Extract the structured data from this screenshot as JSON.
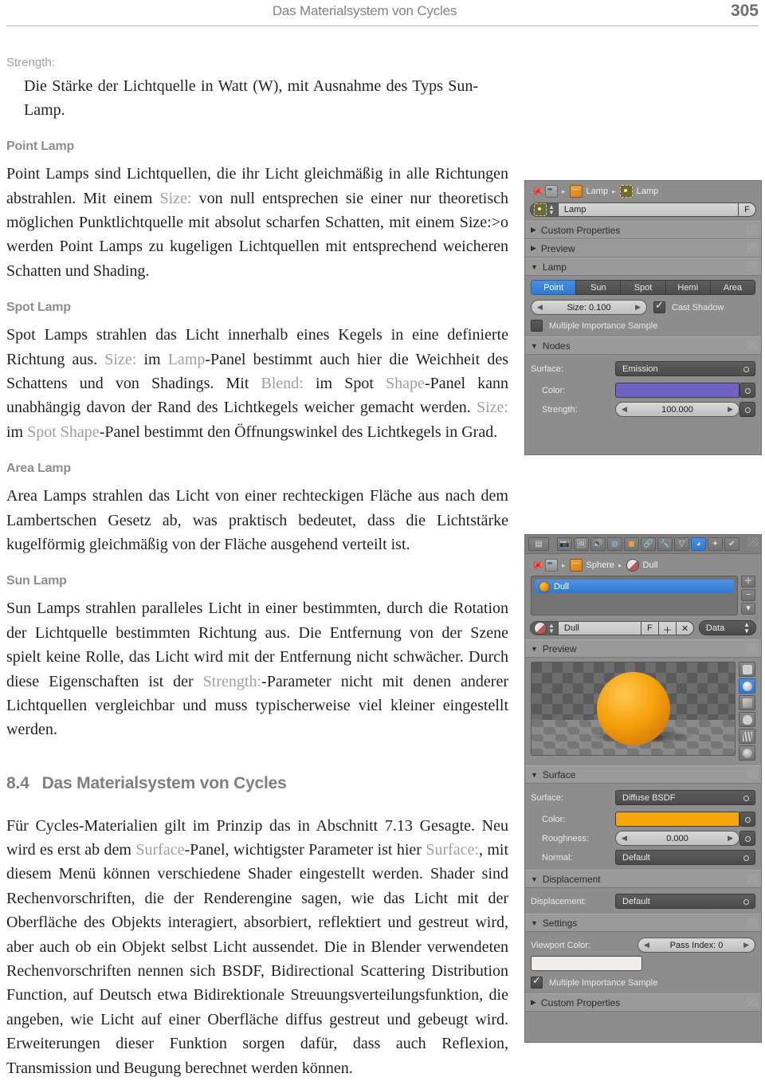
{
  "header": {
    "title": "Das Materialsystem von Cycles",
    "page_number": "305"
  },
  "content": {
    "term_strength": "Strength:",
    "term_strength_def": "Die Stärke der Lichtquelle in Watt (W), mit Ausnahme des Typs Sun-Lamp.",
    "h_point_lamp": "Point Lamp",
    "p_point_1": "Point Lamps sind Lichtquellen, die ihr Licht gleichmäßig in alle Richtungen abstrahlen. Mit einem ",
    "p_point_ui1": "Size:",
    "p_point_2": " von null entsprechen sie einer nur theoretisch möglichen Punktlichtquelle mit absolut scharfen Schatten, mit einem Size:>o werden Point Lamps zu kugeligen Lichtquellen mit entsprechend weicheren Schatten und Shading.",
    "h_spot_lamp": "Spot Lamp",
    "p_spot_1": "Spot Lamps strahlen das Licht innerhalb eines Kegels in eine definierte Richtung aus. ",
    "p_spot_ui1": "Size:",
    "p_spot_2": " im ",
    "p_spot_ui2": "Lamp",
    "p_spot_3": "-Panel bestimmt auch hier die Weichheit des Schattens und von Shadings. Mit ",
    "p_spot_ui3": "Blend:",
    "p_spot_4": " im Spot ",
    "p_spot_ui4": "Shape",
    "p_spot_5": "-Panel kann unabhängig davon der Rand des Lichtkegels weicher gemacht werden. ",
    "p_spot_ui5": "Size:",
    "p_spot_6": " im ",
    "p_spot_ui6": "Spot Shape",
    "p_spot_7": "-Panel bestimmt den Öffnungswinkel des Lichtkegels in Grad.",
    "h_area_lamp": "Area Lamp",
    "p_area": "Area Lamps strahlen das Licht von einer rechteckigen Fläche aus nach dem Lambertschen Gesetz ab, was praktisch bedeutet, dass die Lichtstärke kugelförmig gleichmäßig von der Fläche ausgehend verteilt ist.",
    "h_sun_lamp": "Sun Lamp",
    "p_sun_1": "Sun Lamps strahlen paralleles Licht in einer bestimmten, durch die Rotation der Lichtquelle bestimmten Richtung aus. Die Entfernung von der Szene spielt keine Rolle, das Licht wird mit der Entfernung nicht schwächer. Durch diese Eigenschaften ist der ",
    "p_sun_ui1": "Strength:",
    "p_sun_2": "-Parameter nicht mit denen anderer Lichtquellen vergleichbar und muss typischerweise viel kleiner eingestellt werden.",
    "section_number": "8.4",
    "section_title": "Das Materialsystem von Cycles",
    "p_cycles_1": "Für Cycles-Materialien gilt im Prinzip das in Abschnitt 7.13 Gesagte. Neu wird es erst ab dem ",
    "p_cycles_ui1": "Surface",
    "p_cycles_2": "-Panel, wichtigster Parameter ist hier ",
    "p_cycles_ui2": "Surface:",
    "p_cycles_3": ", mit diesem Menü können verschiedene Shader eingestellt werden. Shader sind Rechenvorschriften, die der Renderengine sagen, wie das Licht mit der Oberfläche des Objekts interagiert, absorbiert, reflektiert und gestreut wird, aber auch ob ein Objekt selbst Licht aussendet. Die in Blender verwendeten Rechenvorschriften nennen sich BSDF, Bidirectional Scattering Distribution Function, auf Deutsch etwa Bidirektionale Streuungsverteilungsfunktion, die angeben, wie Licht auf einer Oberfläche diffus gestreut und gebeugt wird. Erweiterungen dieser Funktion sorgen dafür, dass auch Reflexion, Transmission und Beugung berechnet werden können."
  },
  "lamp_panel": {
    "breadcrumb": [
      "Lamp",
      "Lamp"
    ],
    "name_value": "Lamp",
    "fake_user_label": "F",
    "panels": [
      {
        "label": "Custom Properties",
        "open": false
      },
      {
        "label": "Preview",
        "open": false
      },
      {
        "label": "Lamp",
        "open": true
      },
      {
        "label": "Nodes",
        "open": true
      }
    ],
    "lamp_types": [
      "Point",
      "Sun",
      "Spot",
      "Hemi",
      "Area"
    ],
    "lamp_type_selected": "Point",
    "size_label": "Size: 0.100",
    "cast_shadow_label": "Cast Shadow",
    "cast_shadow_checked": true,
    "mis_label": "Multiple Importance Sample",
    "mis_checked": false,
    "nodes": {
      "surface_label": "Surface:",
      "surface_value": "Emission",
      "color_label": "Color:",
      "color_value": "#6f62c4",
      "strength_label": "Strength:",
      "strength_value": "100.000"
    }
  },
  "material_panel": {
    "tab_icons": [
      "render-icon",
      "render-layers-icon",
      "scene-icon",
      "world-icon",
      "object-icon",
      "constraints-icon",
      "modifiers-icon",
      "object-data-icon",
      "material-icon",
      "particles-icon",
      "physics-icon"
    ],
    "tab_selected_index": 8,
    "breadcrumb": [
      "Sphere",
      "Dull"
    ],
    "list_items": [
      "Dull"
    ],
    "list_selected": "Dull",
    "name_value": "Dull",
    "fake_user_label": "F",
    "data_dropdown": "Data",
    "panels": [
      {
        "label": "Preview",
        "open": true
      },
      {
        "label": "Surface",
        "open": true
      },
      {
        "label": "Displacement",
        "open": true
      },
      {
        "label": "Settings",
        "open": true
      },
      {
        "label": "Custom Properties",
        "open": false
      }
    ],
    "preview_modes": [
      "flat-preview-icon",
      "sphere-preview-icon",
      "cube-preview-icon",
      "monkey-preview-icon",
      "hair-preview-icon",
      "world-preview-icon"
    ],
    "preview_mode_selected": 1,
    "surface": {
      "surface_label": "Surface:",
      "surface_value": "Diffuse BSDF",
      "color_label": "Color:",
      "color_value": "#f5a608",
      "roughness_label": "Roughness:",
      "roughness_value": "0.000",
      "normal_label": "Normal:",
      "normal_value": "Default"
    },
    "displacement": {
      "label": "Displacement:",
      "value": "Default"
    },
    "settings": {
      "viewport_color_label": "Viewport Color:",
      "viewport_color_value": "#f0eeea",
      "pass_index_label": "Pass Index: 0",
      "mis_label": "Multiple Importance Sample",
      "mis_checked": true
    }
  }
}
